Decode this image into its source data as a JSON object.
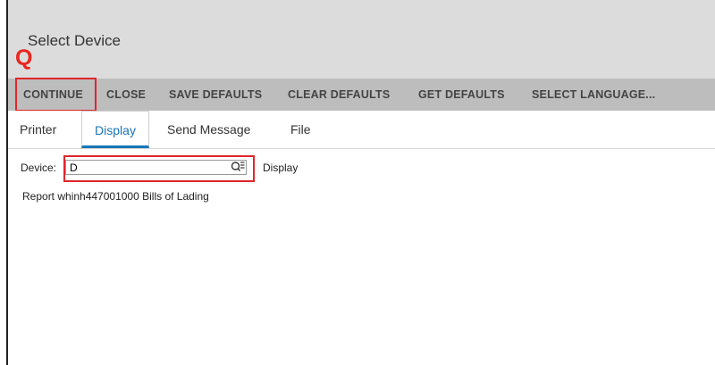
{
  "window": {
    "title": "Select Device"
  },
  "annotation": {
    "marker": "Q"
  },
  "toolbar": {
    "buttons": [
      {
        "label": "CONTINUE"
      },
      {
        "label": "CLOSE"
      },
      {
        "label": "SAVE DEFAULTS"
      },
      {
        "label": "CLEAR DEFAULTS"
      },
      {
        "label": "GET DEFAULTS"
      },
      {
        "label": "SELECT LANGUAGE..."
      }
    ]
  },
  "tabs": [
    {
      "label": "Printer"
    },
    {
      "label": "Display",
      "active": true
    },
    {
      "label": "Send Message"
    },
    {
      "label": "File"
    }
  ],
  "form": {
    "device_label": "Device:",
    "device_value": "D",
    "device_description": "Display",
    "report_text": "Report whinh447001000 Bills of Lading"
  },
  "colors": {
    "accent": "#1a74b8",
    "annotation": "#e0262b",
    "titlebar": "#dcdcdc",
    "toolbar": "#bdbdbd"
  },
  "icons": {
    "lookup": "search-list-icon"
  }
}
